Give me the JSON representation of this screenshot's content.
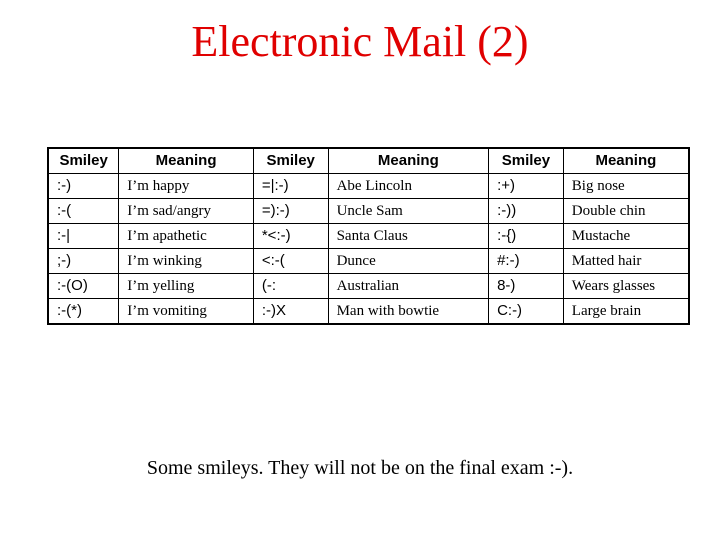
{
  "title": "Electronic Mail (2)",
  "table": {
    "headers": [
      "Smiley",
      "Meaning",
      "Smiley",
      "Meaning",
      "Smiley",
      "Meaning"
    ],
    "rows": [
      [
        ":-)",
        "I’m happy",
        "=|:-)",
        "Abe Lincoln",
        ":+)",
        "Big nose"
      ],
      [
        ":-(",
        "I’m sad/angry",
        "=):-)",
        "Uncle Sam",
        ":-))",
        "Double chin"
      ],
      [
        ":-|",
        "I’m apathetic",
        "*<:-)",
        "Santa Claus",
        ":-{)",
        "Mustache"
      ],
      [
        ";-)",
        "I’m winking",
        "<:-(",
        "Dunce",
        "#:-)",
        "Matted hair"
      ],
      [
        ":-(O)",
        "I’m yelling",
        "(-:",
        "Australian",
        "8-)",
        "Wears glasses"
      ],
      [
        ":-(*)",
        "I’m vomiting",
        ":-)X",
        "Man with bowtie",
        "C:-)",
        "Large brain"
      ]
    ]
  },
  "caption": "Some smileys.  They will not be on the final exam :-).",
  "colors": {
    "title": "#e00000",
    "text": "#000000",
    "background": "#ffffff"
  }
}
